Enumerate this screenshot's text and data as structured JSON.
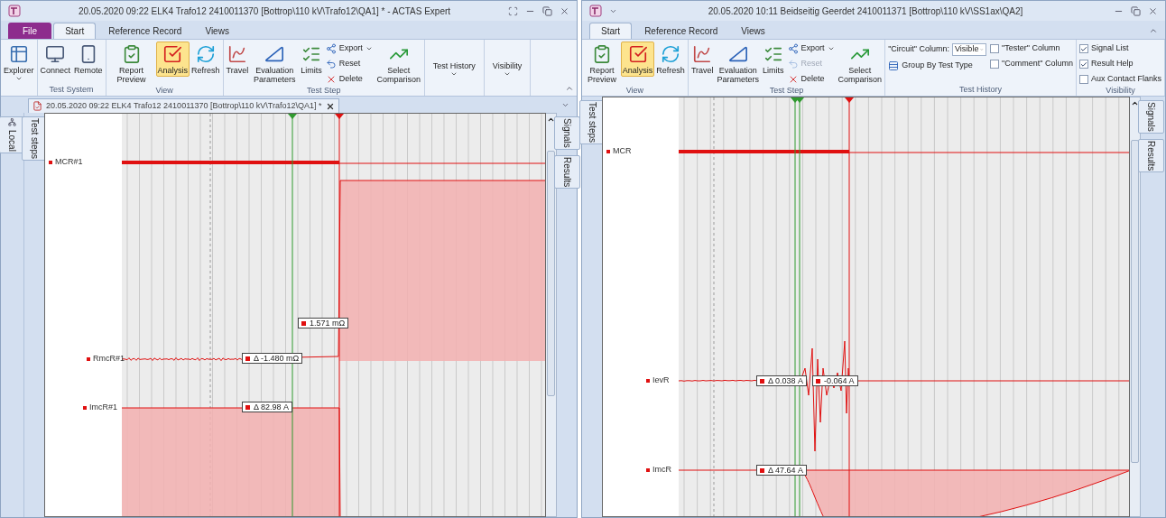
{
  "windows": [
    {
      "title": "20.05.2020 09:22 ELK4 Trafo12 2410011370 [Bottrop\\110 kV\\Trafo12\\QA1] * - ACTAS Expert",
      "ribbon_tabs": [
        {
          "label": "File",
          "kind": "file",
          "selected": false
        },
        {
          "label": "Start",
          "kind": "tab",
          "selected": true
        },
        {
          "label": "Reference Record",
          "kind": "tab",
          "selected": false
        },
        {
          "label": "Views",
          "kind": "tab",
          "selected": false
        }
      ],
      "ribbon_groups": [
        {
          "items": [
            {
              "kind": "large",
              "label": "Explorer",
              "dropdown": true,
              "selected": false
            }
          ]
        },
        {
          "label": "Test System",
          "items": [
            {
              "kind": "large",
              "label": "Connect",
              "selected": false
            },
            {
              "kind": "large",
              "label": "Remote",
              "selected": false
            }
          ]
        },
        {
          "label": "View",
          "items": [
            {
              "kind": "large",
              "label": "Report Preview",
              "selected": false
            },
            {
              "kind": "large",
              "label": "Analysis",
              "selected": true
            },
            {
              "kind": "large",
              "label": "Refresh",
              "selected": false
            }
          ]
        },
        {
          "label": "Test Step",
          "items": [
            {
              "kind": "large",
              "label": "Travel",
              "selected": false
            },
            {
              "kind": "large",
              "label": "Evaluation Parameters",
              "selected": false
            },
            {
              "kind": "large",
              "label": "Limits",
              "selected": false
            },
            {
              "kind": "stack",
              "items": [
                {
                  "kind": "small",
                  "label": "Export",
                  "dropdown": true,
                  "disabled": false
                },
                {
                  "kind": "small",
                  "label": "Reset",
                  "disabled": false
                },
                {
                  "kind": "small",
                  "label": "Delete",
                  "disabled": false
                }
              ]
            },
            {
              "kind": "large",
              "label": "Select Comparison",
              "selected": false
            }
          ]
        },
        {
          "items": [
            {
              "kind": "collapsed",
              "label": "Test History"
            }
          ]
        },
        {
          "items": [
            {
              "kind": "collapsed",
              "label": "Visibility"
            }
          ]
        }
      ],
      "document_tab": {
        "label": "20.05.2020 09:22 ELK4 Trafo12 2410011370 [Bottrop\\110 kV\\Trafo12\\QA1] *"
      },
      "outer_tabs": [
        {
          "label": "Local"
        }
      ],
      "left_tabs": [
        {
          "label": "Test steps"
        }
      ],
      "right_tabs": [
        {
          "label": "Signals"
        },
        {
          "label": "Results"
        }
      ],
      "chart": {
        "signals": [
          {
            "label": "MCR#1"
          },
          {
            "label": "RmcR#1"
          },
          {
            "label": "ImcR#1"
          }
        ],
        "readouts": [
          {
            "text": "1.571 mΩ"
          },
          {
            "text": "Δ -1.480 mΩ"
          },
          {
            "text": "Δ 82.98 A"
          }
        ]
      }
    },
    {
      "title": "20.05.2020 10:11 Beidseitig Geerdet 2410011371 [Bottrop\\110 kV\\SS1ax\\QA2]",
      "ribbon_tabs": [
        {
          "label": "Start",
          "kind": "tab",
          "selected": true
        },
        {
          "label": "Reference Record",
          "kind": "tab",
          "selected": false
        },
        {
          "label": "Views",
          "kind": "tab",
          "selected": false
        }
      ],
      "ribbon_groups": [
        {
          "label": "View",
          "items": [
            {
              "kind": "large",
              "label": "Report Preview",
              "selected": false
            },
            {
              "kind": "large",
              "label": "Analysis",
              "selected": true
            },
            {
              "kind": "large",
              "label": "Refresh",
              "selected": false
            }
          ]
        },
        {
          "label": "Test Step",
          "items": [
            {
              "kind": "large",
              "label": "Travel",
              "selected": false
            },
            {
              "kind": "large",
              "label": "Evaluation Parameters",
              "selected": false
            },
            {
              "kind": "large",
              "label": "Limits",
              "selected": false
            },
            {
              "kind": "stack",
              "items": [
                {
                  "kind": "small",
                  "label": "Export",
                  "dropdown": true,
                  "disabled": false
                },
                {
                  "kind": "small",
                  "label": "Reset",
                  "disabled": true
                },
                {
                  "kind": "small",
                  "label": "Delete",
                  "disabled": false
                }
              ]
            },
            {
              "kind": "large",
              "label": "Select Comparison",
              "selected": false
            }
          ]
        },
        {
          "label": "Test History",
          "items": [
            {
              "kind": "stack",
              "items": [
                {
                  "kind": "combo",
                  "label": "\"Circuit\" Column:",
                  "value": "Visible"
                },
                {
                  "kind": "small",
                  "label": "Group By Test Type",
                  "disabled": false
                }
              ]
            },
            {
              "kind": "stack",
              "items": [
                {
                  "kind": "checkbox",
                  "label": "\"Tester\" Column",
                  "checked": false
                },
                {
                  "kind": "checkbox",
                  "label": "\"Comment\" Column",
                  "checked": false
                }
              ]
            }
          ]
        },
        {
          "label": "Visibility",
          "items": [
            {
              "kind": "stack",
              "items": [
                {
                  "kind": "checkbox",
                  "label": "Signal List",
                  "checked": true
                },
                {
                  "kind": "checkbox",
                  "label": "Result Help",
                  "checked": true
                },
                {
                  "kind": "checkbox",
                  "label": "Aux Contact Flanks",
                  "checked": false
                }
              ]
            }
          ]
        }
      ],
      "left_tabs": [
        {
          "label": "Test steps"
        }
      ],
      "right_tabs": [
        {
          "label": "Signals"
        },
        {
          "label": "Results"
        }
      ],
      "chart": {
        "signals": [
          {
            "label": "MCR"
          },
          {
            "label": "IevR"
          },
          {
            "label": "ImcR"
          }
        ],
        "readouts": [
          {
            "text": "Δ 0.038 A"
          },
          {
            "text": "-0.064 A"
          },
          {
            "text": "Δ 47.64 A"
          }
        ]
      }
    }
  ]
}
